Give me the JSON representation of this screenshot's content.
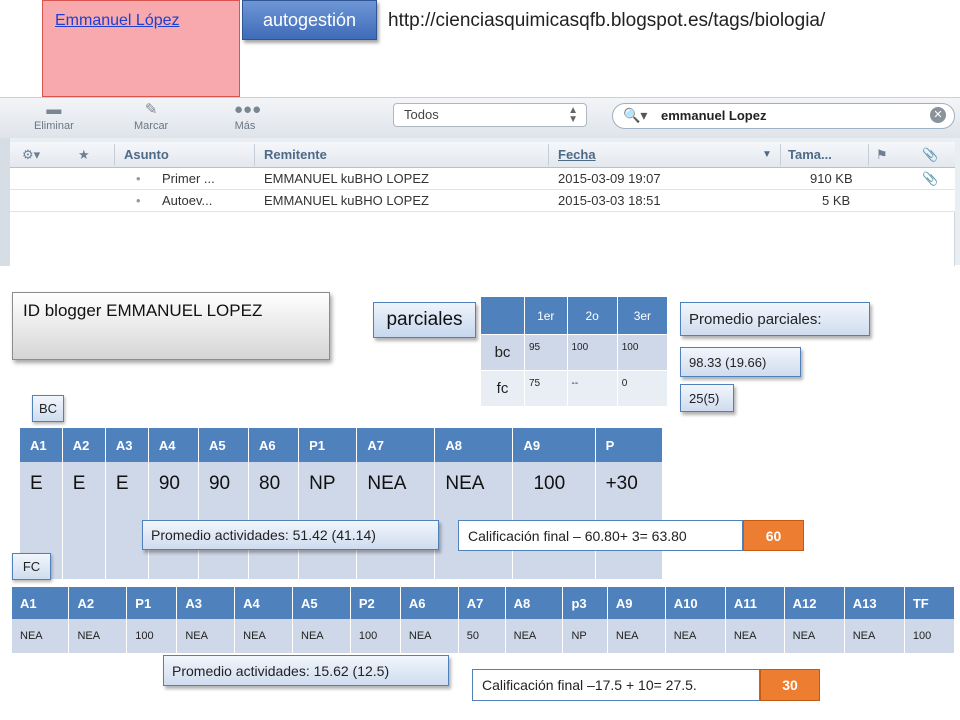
{
  "header": {
    "name_link": "Emmanuel López",
    "autogestion": "autogestión",
    "url": "http://cienciasquimicasqfb.blogspot.es/tags/biologia/"
  },
  "mail": {
    "toolbar": {
      "eliminar": "Eliminar",
      "marcar": "Marcar",
      "mas": "Más"
    },
    "filter_select": "Todos",
    "search_value": "emmanuel Lopez",
    "columns": {
      "asunto": "Asunto",
      "remitente": "Remitente",
      "fecha": "Fecha",
      "tamano": "Tama..."
    },
    "rows": [
      {
        "asunto": "Primer ...",
        "remitente": "EMMANUEL kuBHO LOPEZ",
        "fecha": "2015-03-09 19:07",
        "tamano": "910 KB"
      },
      {
        "asunto": "Autoev...",
        "remitente": "EMMANUEL kuBHO LOPEZ",
        "fecha": "2015-03-03 18:51",
        "tamano": "5 KB"
      }
    ]
  },
  "id_box": {
    "text": "ID blogger  EMMANUEL LOPEZ"
  },
  "parciales": {
    "label": "parciales",
    "headers": [
      "",
      "1er",
      "2o",
      "3er"
    ],
    "rows": [
      {
        "name": "bc",
        "values": [
          "95",
          "100",
          "100"
        ]
      },
      {
        "name": "fc",
        "values": [
          "75",
          "--",
          "0"
        ]
      }
    ],
    "promedio_label": "Promedio parciales:",
    "promedio_bc": "98.33 (19.66)",
    "promedio_fc": "25(5)"
  },
  "bc": {
    "tag": "BC",
    "headers": [
      "A1",
      "A2",
      "A3",
      "A4",
      "A5",
      "A6",
      "P1",
      "A7",
      "A8",
      "A9",
      "P"
    ],
    "values": [
      "E",
      "E",
      "E",
      "90",
      "90",
      "80",
      "NP",
      "NEA",
      "NEA",
      "100",
      "+30"
    ],
    "promedio": "Promedio actividades: 51.42  (41.14)",
    "calificacion": "Calificación final – 60.80+ 3= 63.80",
    "final": "60"
  },
  "fc": {
    "tag": "FC",
    "headers": [
      "A1",
      "A2",
      "P1",
      "A3",
      "A4",
      "A5",
      "P2",
      "A6",
      "A7",
      "A8",
      "p3",
      "A9",
      "A10",
      "A11",
      "A12",
      "A13",
      "TF"
    ],
    "values": [
      "NEA",
      "NEA",
      "100",
      "NEA",
      "NEA",
      "NEA",
      "100",
      "NEA",
      "50",
      "NEA",
      "NP",
      "NEA",
      "NEA",
      "NEA",
      "NEA",
      "NEA",
      "100"
    ],
    "promedio": "Promedio actividades: 15.62 (12.5)",
    "calificacion": "Calificación final –17.5  + 10= 27.5.",
    "final": "30"
  },
  "colors": {
    "accent_blue": "#4f81bd",
    "orange": "#ed7d31",
    "pink_box": "#f7a9ad"
  }
}
